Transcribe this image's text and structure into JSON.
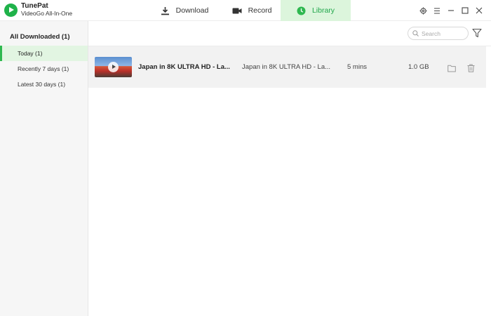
{
  "app": {
    "name": "TunePat",
    "subtitle": "VideoGo All-In-One"
  },
  "tabs": [
    {
      "label": "Download",
      "icon": "download-icon",
      "active": false
    },
    {
      "label": "Record",
      "icon": "video-camera-icon",
      "active": false
    },
    {
      "label": "Library",
      "icon": "clock-icon",
      "active": true
    }
  ],
  "window_controls": [
    "settings-icon",
    "menu-icon",
    "minimize-icon",
    "maximize-icon",
    "close-icon"
  ],
  "sidebar": {
    "heading": "All Downloaded (1)",
    "items": [
      {
        "label": "Today (1)",
        "active": true
      },
      {
        "label": "Recently 7 days (1)",
        "active": false
      },
      {
        "label": "Latest 30 days (1)",
        "active": false
      }
    ]
  },
  "toolbar": {
    "search_placeholder": "Search"
  },
  "items": [
    {
      "title": "Japan in 8K ULTRA HD - La...",
      "file_name": "Japan in 8K ULTRA HD - La...",
      "duration": "5 mins",
      "size": "1.0 GB"
    }
  ],
  "colors": {
    "accent": "#1fb24a",
    "tab_active_bg": "#dcf5dc",
    "sidebar_active_bg": "#e2f5e2",
    "row_bg": "#f2f2f2"
  }
}
